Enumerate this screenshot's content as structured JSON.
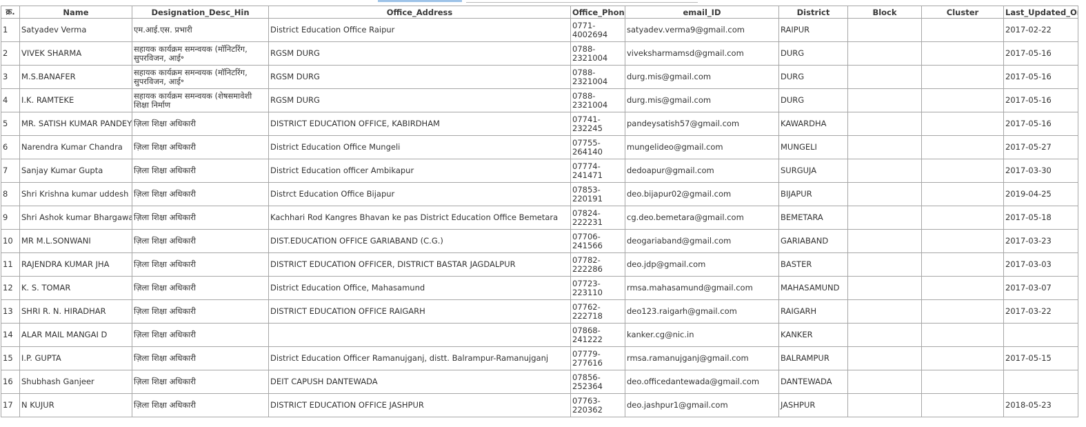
{
  "table": {
    "columns": [
      "क्र.",
      "Name",
      "Designation_Desc_Hin",
      "Office_Address",
      "Office_Phone",
      "email_ID",
      "District",
      "Block",
      "Cluster",
      "Last_Updated_On"
    ],
    "rows": [
      [
        "1",
        "Satyadev Verma",
        "एम.आई.एस. प्रभारी",
        "District Education Office Raipur",
        "0771-4002694",
        "satyadev.verma9@gmail.com",
        "RAIPUR",
        "",
        "",
        "2017-02-22"
      ],
      [
        "2",
        "VIVEK SHARMA",
        "सहायक कार्यक्रम समन्वयक (मॉनिटरिंग, सुपरविजन, आई॰",
        "RGSM DURG",
        "0788-2321004",
        "viveksharmamsd@gmail.com",
        "DURG",
        "",
        "",
        "2017-05-16"
      ],
      [
        "3",
        "M.S.BANAFER",
        "सहायक कार्यक्रम समन्वयक (मॉनिटरिंग, सुपरविजन, आई॰",
        "RGSM DURG",
        "0788-2321004",
        "durg.mis@gmail.com",
        "DURG",
        "",
        "",
        "2017-05-16"
      ],
      [
        "4",
        "I.K. RAMTEKE",
        "सहायक कार्यक्रम समन्वयक (शेषसमावेशी शिक्षा निर्माण",
        "RGSM DURG",
        "0788-2321004",
        "durg.mis@gmail.com",
        "DURG",
        "",
        "",
        "2017-05-16"
      ],
      [
        "5",
        "MR. SATISH KUMAR PANDEY",
        "ज़िला शिक्षा अधिकारी",
        "DISTRICT EDUCATION OFFICE, KABIRDHAM",
        "07741-232245",
        "pandeysatish57@gmail.com",
        "KAWARDHA",
        "",
        "",
        "2017-05-16"
      ],
      [
        "6",
        "Narendra Kumar Chandra",
        "ज़िला शिक्षा अधिकारी",
        "District Education Office Mungeli",
        "07755-264140",
        "mungelideo@gmail.com",
        "MUNGELI",
        "",
        "",
        "2017-05-27"
      ],
      [
        "7",
        "Sanjay Kumar Gupta",
        "ज़िला शिक्षा अधिकारी",
        "District Education officer Ambikapur",
        "07774-241471",
        "dedoapur@gmail.com",
        "SURGUJA",
        "",
        "",
        "2017-03-30"
      ],
      [
        "8",
        "Shri Krishna kumar uddesh",
        "ज़िला शिक्षा अधिकारी",
        "Distrct Education Office Bijapur",
        "07853-220191",
        "deo.bijapur02@gmail.com",
        "BIJAPUR",
        "",
        "",
        "2019-04-25"
      ],
      [
        "9",
        "Shri Ashok kumar Bhargawa",
        "ज़िला शिक्षा अधिकारी",
        "Kachhari Rod Kangres Bhavan ke pas District Education Office Bemetara",
        "07824-222231",
        "cg.deo.bemetara@gmail.com",
        "BEMETARA",
        "",
        "",
        "2017-05-18"
      ],
      [
        "10",
        "MR M.L.SONWANI",
        "ज़िला शिक्षा अधिकारी",
        "DIST.EDUCATION OFFICE GARIABAND (C.G.)",
        "07706-241566",
        "deogariaband@gmail.com",
        "GARIABAND",
        "",
        "",
        "2017-03-23"
      ],
      [
        "11",
        "RAJENDRA KUMAR JHA",
        "ज़िला शिक्षा अधिकारी",
        "DISTRICT EDUCATION OFFICER, DISTRICT BASTAR JAGDALPUR",
        "07782-222286",
        "deo.jdp@gmail.com",
        "BASTER",
        "",
        "",
        "2017-03-03"
      ],
      [
        "12",
        "K. S. TOMAR",
        "ज़िला शिक्षा अधिकारी",
        "District Education Office, Mahasamund",
        "07723-223110",
        "rmsa.mahasamund@gmail.com",
        "MAHASAMUND",
        "",
        "",
        "2017-03-07"
      ],
      [
        "13",
        "SHRI R. N. HIRADHAR",
        "ज़िला शिक्षा अधिकारी",
        "DISTRICT EDUCATION OFFICE RAIGARH",
        "07762-222718",
        "deo123.raigarh@gmail.com",
        "RAIGARH",
        "",
        "",
        "2017-03-22"
      ],
      [
        "14",
        "ALAR MAIL MANGAI D",
        "ज़िला शिक्षा अधिकारी",
        "",
        "07868-241222",
        "kanker.cg@nic.in",
        "KANKER",
        "",
        "",
        ""
      ],
      [
        "15",
        "I.P. GUPTA",
        "ज़िला शिक्षा अधिकारी",
        "District Education Officer Ramanujganj, distt. Balrampur-Ramanujganj",
        "07779-277616",
        "rmsa.ramanujganj@gmail.com",
        "BALRAMPUR",
        "",
        "",
        "2017-05-15"
      ],
      [
        "16",
        "Shubhash Ganjeer",
        "ज़िला शिक्षा अधिकारी",
        "DEIT CAPUSH DANTEWADA",
        "07856-252364",
        "deo.officedantewada@gmail.com",
        "DANTEWADA",
        "",
        "",
        ""
      ],
      [
        "17",
        "N KUJUR",
        "ज़िला शिक्षा अधिकारी",
        "DISTRICT EDUCATION OFFICE JASHPUR",
        "07763-220362",
        "deo.jashpur1@gmail.com",
        "JASHPUR",
        "",
        "",
        "2018-05-23"
      ]
    ]
  }
}
